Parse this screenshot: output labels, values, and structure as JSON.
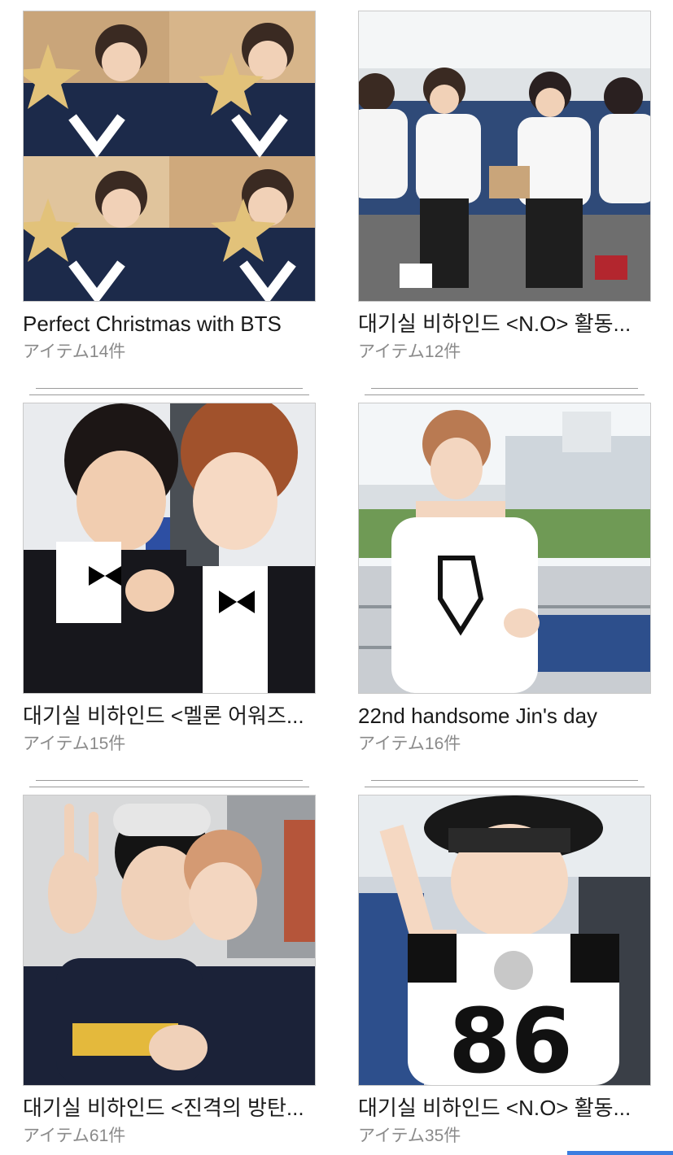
{
  "albums": [
    {
      "title": "Perfect Christmas with BTS",
      "count": "アイテム14件",
      "photo_icon": "christmas-photo"
    },
    {
      "title": "대기실 비하인드 <N.O> 활동...",
      "count": "アイテム12件",
      "photo_icon": "group-photo"
    },
    {
      "title": "대기실 비하인드 <멜론 어워즈...",
      "count": "アイテム15件",
      "photo_icon": "tuxedo-photo"
    },
    {
      "title": "22nd handsome Jin's day",
      "count": "アイテム16件",
      "photo_icon": "rooftop-photo"
    },
    {
      "title": "대기실 비하인드 <진격의 방탄...",
      "count": "アイテム61件",
      "photo_icon": "selfie-photo"
    },
    {
      "title": "대기실 비하인드 <N.O> 활동...",
      "count": "アイテム35件",
      "photo_icon": "bandana-photo"
    }
  ],
  "colors": {
    "title_text": "#1a1a1a",
    "count_text": "#8a8a8a",
    "accent_indicator": "#3b7de0"
  }
}
